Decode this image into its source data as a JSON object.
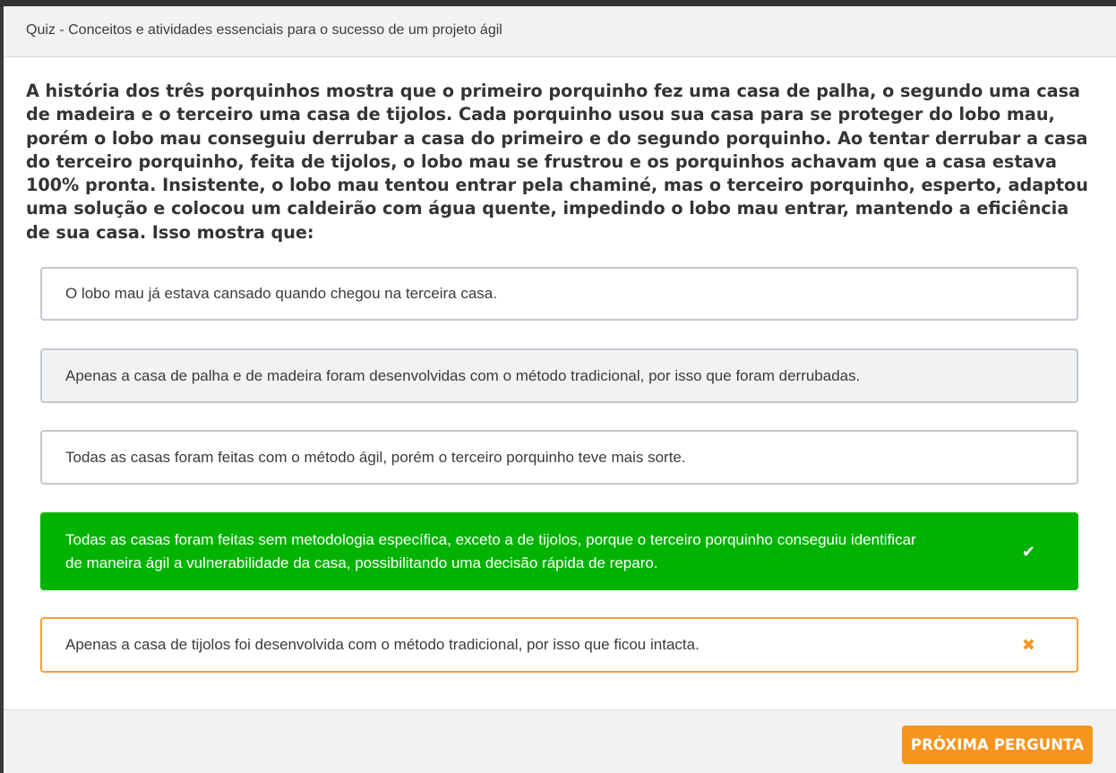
{
  "header": {
    "title": "Quiz - Conceitos e atividades essenciais para o sucesso de um projeto ágil"
  },
  "question": {
    "text": "A história dos três porquinhos mostra que o primeiro porquinho fez uma casa de palha, o segundo uma casa de madeira e o terceiro uma casa de tijolos. Cada porquinho usou sua casa para se proteger do lobo mau, porém o lobo mau conseguiu derrubar a casa do primeiro e do segundo porquinho. Ao tentar derrubar a casa do terceiro porquinho, feita de tijolos, o lobo mau se frustrou e os porquinhos achavam que a casa estava 100% pronta. Insistente, o lobo mau tentou entrar pela chaminé, mas o terceiro porquinho, esperto, adaptou uma solução e colocou um caldeirão com água quente, impedindo o lobo mau entrar, mantendo a eficiência de sua casa. Isso mostra que:"
  },
  "options": [
    {
      "text": "O lobo mau já estava cansado quando chegou na terceira casa.",
      "state": "default"
    },
    {
      "text": "Apenas a casa de palha e de madeira foram desenvolvidas com o método tradicional, por isso que foram derrubadas.",
      "state": "hover"
    },
    {
      "text": "Todas as casas foram feitas com o método ágil, porém o terceiro porquinho teve mais sorte.",
      "state": "default"
    },
    {
      "text": "Todas as casas foram feitas sem metodologia específica, exceto a de tijolos, porque o terceiro porquinho conseguiu identificar de maneira ágil a vulnerabilidade da casa, possibilitando uma decisão rápida de reparo.",
      "state": "correct",
      "icon": "check-icon",
      "icon_glyph": "✔"
    },
    {
      "text": "Apenas a casa de tijolos foi desenvolvida com o método tradicional, por isso que ficou intacta.",
      "state": "wrong",
      "icon": "cross-icon",
      "icon_glyph": "✖"
    }
  ],
  "footer": {
    "next_label": "PRÓXIMA PERGUNTA"
  },
  "colors": {
    "correct": "#00b300",
    "wrong": "#f5a03a",
    "button": "#f7941d"
  }
}
